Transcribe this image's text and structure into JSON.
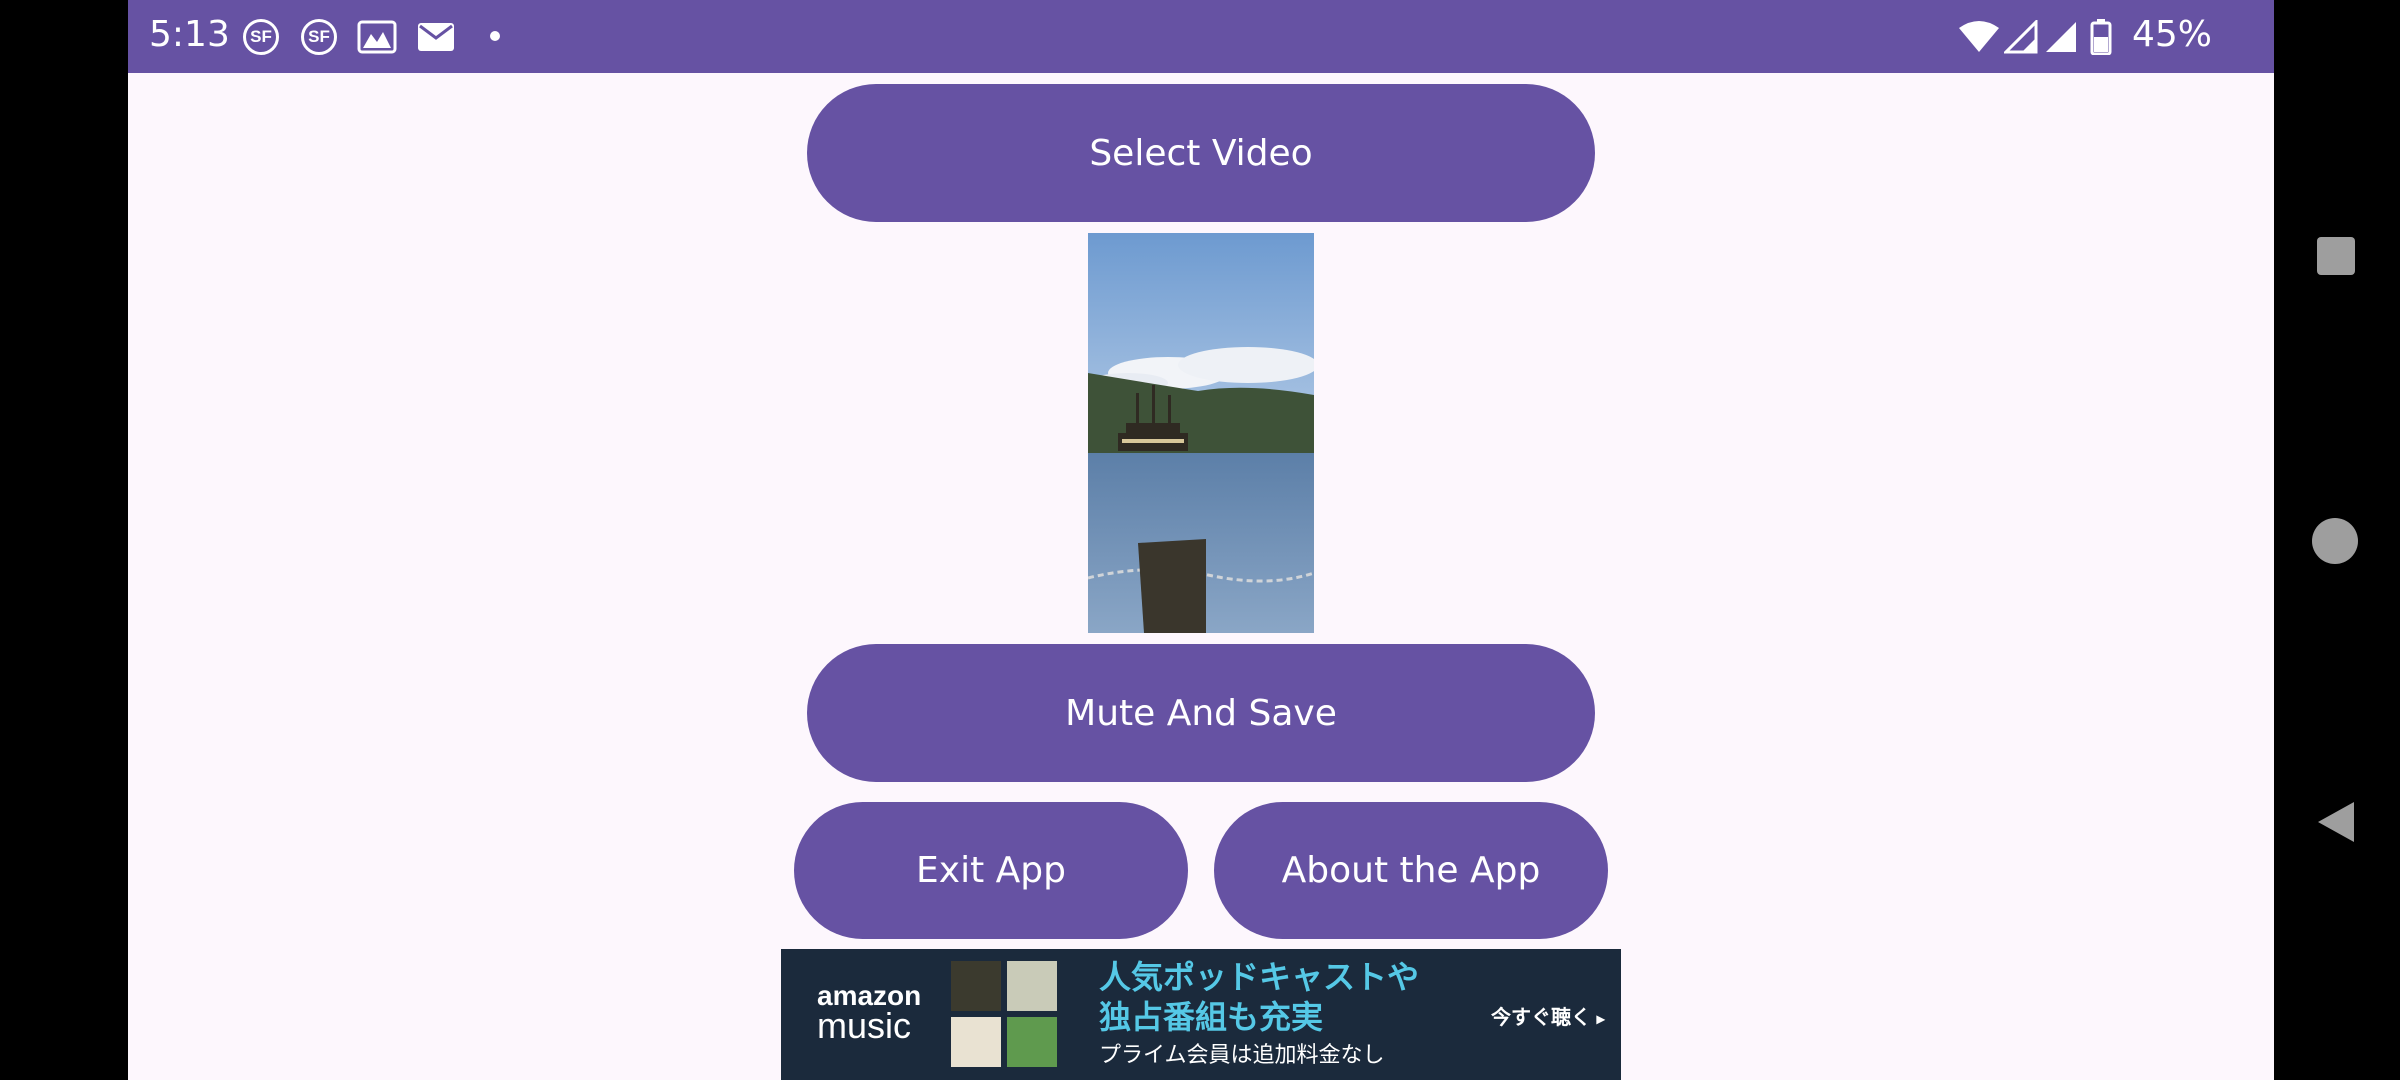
{
  "status_bar": {
    "time": "5:13",
    "notification_icons": [
      "sf-icon",
      "sf-icon",
      "gallery-icon",
      "mail-icon",
      "dot-icon"
    ],
    "sf_label": "SF",
    "battery_percent": "45%",
    "system_icons": [
      "wifi-icon",
      "signal-icon",
      "signal-icon",
      "battery-icon"
    ]
  },
  "buttons": {
    "select_video": "Select Video",
    "mute_and_save": "Mute And Save",
    "exit_app": "Exit App",
    "about_app": "About the App"
  },
  "ad_banner": {
    "logo_line1": "amazon",
    "logo_line2": "music",
    "headline_line1": "人気ポッドキャストや",
    "headline_line2": "独占番組も充実",
    "subtext": "プライム会員は追加料金なし",
    "cta": "今すぐ聴く"
  },
  "nav_bar": {
    "icons": [
      "recents-icon",
      "home-icon",
      "back-icon"
    ]
  },
  "colors": {
    "primary": "#6652a3",
    "background": "#fdf7fd",
    "ad_headline": "#55c8e6"
  }
}
